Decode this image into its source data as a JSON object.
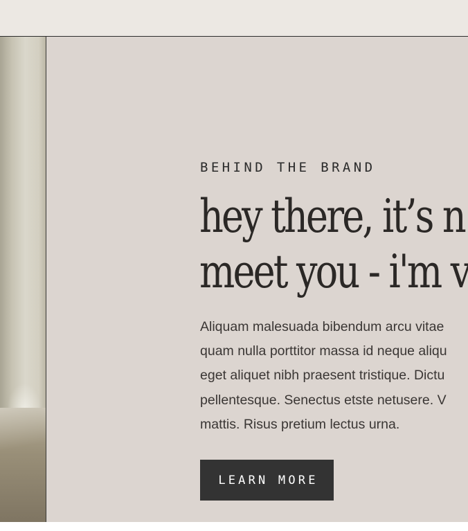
{
  "eyebrow": "BEHIND THE BRAND",
  "headline": {
    "line1": "hey there, it’s n",
    "line2": "meet you - i'm v"
  },
  "body": {
    "lines": [
      "Aliquam malesuada bibendum arcu vitae",
      "quam nulla porttitor massa id neque aliqu",
      "eget aliquet nibh praesent tristique. Dictu",
      "pellentesque. Senectus etste netusere. V",
      "mattis. Risus pretium lectus urna."
    ]
  },
  "cta": {
    "label": "LEARN MORE"
  },
  "colors": {
    "topbar": "#ece8e3",
    "panel": "#dcd5d0",
    "button": "#333333",
    "text": "#2b2826"
  }
}
